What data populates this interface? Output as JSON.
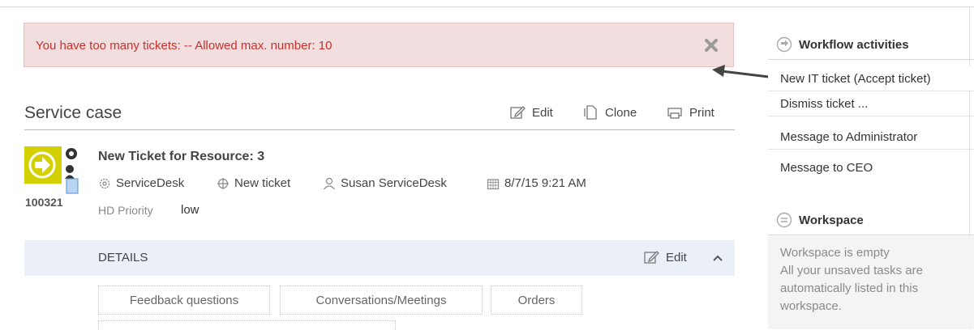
{
  "alert": {
    "message": "You have too many tickets: -- Allowed max. number: 10",
    "close_icon": "close-x-icon"
  },
  "service_case": {
    "title": "Service case",
    "actions": {
      "edit": "Edit",
      "clone": "Clone",
      "print": "Print"
    }
  },
  "ticket": {
    "id": "100321",
    "title": "New Ticket for Resource: 3",
    "meta": {
      "desk": "ServiceDesk",
      "status": "New ticket",
      "user": "Susan ServiceDesk",
      "date": "8/7/15 9:21 AM"
    },
    "priority_label": "HD Priority",
    "priority_value": "low"
  },
  "details": {
    "label": "DETAILS",
    "edit": "Edit",
    "tabs": [
      "Feedback questions",
      "Conversations/Meetings",
      "Orders"
    ]
  },
  "workflow": {
    "title": "Workflow activities",
    "items": [
      "New IT ticket (Accept ticket)",
      "Dismiss ticket ...",
      "Message to Administrator",
      "Message to CEO"
    ]
  },
  "workspace": {
    "title": "Workspace",
    "empty_title": "Workspace is empty",
    "empty_lines": [
      "All your unsaved tasks are",
      "automatically listed in this",
      "workspace."
    ]
  },
  "colors": {
    "alert_bg": "#f2dede",
    "alert_text": "#c9302c",
    "details_bg": "#eaeff8",
    "ticket_icon_bg": "#d8d800"
  }
}
